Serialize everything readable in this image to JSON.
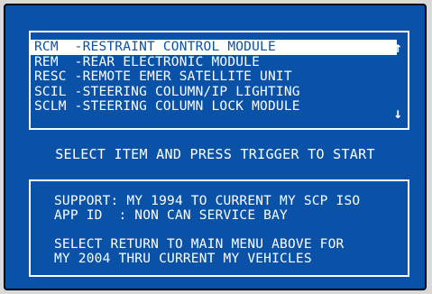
{
  "menu": {
    "items": [
      "RCM  -RESTRAINT CONTROL MODULE",
      "REM  -REAR ELECTRONIC MODULE",
      "RESC -REMOTE EMER SATELLITE UNIT",
      "SCIL -STEERING COLUMN/IP LIGHTING",
      "SCLM -STEERING COLUMN LOCK MODULE"
    ],
    "selected_index": 0,
    "scroll_up_glyph": "↑",
    "scroll_down_glyph": "↓"
  },
  "instruction": "SELECT ITEM AND PRESS TRIGGER TO START",
  "info": {
    "support_line": "SUPPORT: MY 1994 TO CURRENT MY SCP ISO",
    "app_id_line": "APP ID  : NON CAN SERVICE BAY",
    "note_line_1": "SELECT RETURN TO MAIN MENU ABOVE FOR",
    "note_line_2": "MY 2004 THRU CURRENT MY VEHICLES"
  },
  "colors": {
    "background": "#0a52a8",
    "text": "#ffffff",
    "frame": "#d9d9d9"
  }
}
